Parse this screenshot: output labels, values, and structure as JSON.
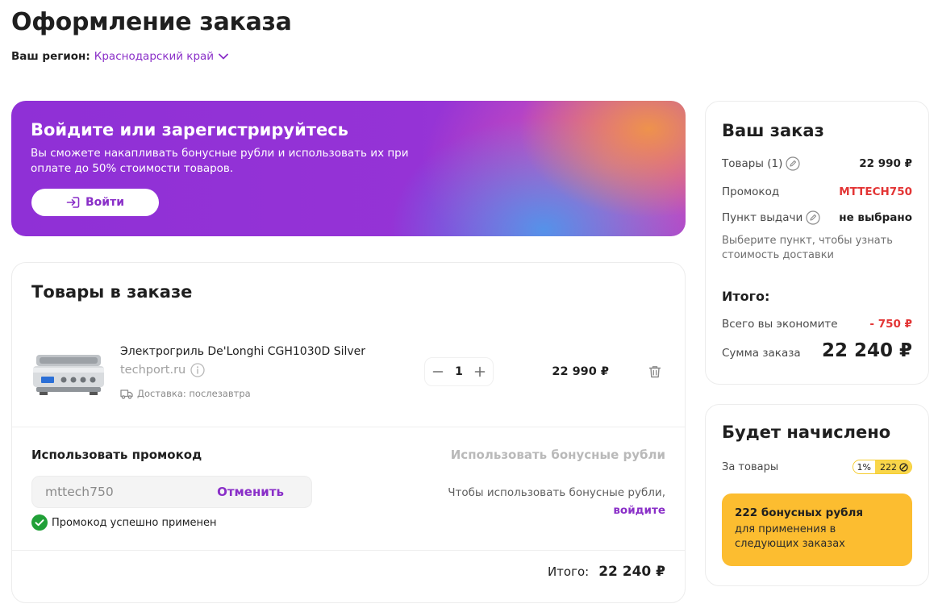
{
  "page": {
    "title": "Оформление заказа",
    "region_label": "Ваш регион:",
    "region_value": "Краснодарский край"
  },
  "banner": {
    "title": "Войдите или зарегистрируйтесь",
    "text": "Вы сможете накапливать бонусные рубли и использовать их при оплате до 50% стоимости товаров.",
    "login_label": "Войти"
  },
  "goods": {
    "title": "Товары в заказе",
    "items": [
      {
        "name": "Электрогриль De'Longhi CGH1030D Silver",
        "shop": "techport.ru",
        "delivery": "Доставка: послезавтра",
        "quantity": "1",
        "price": "22 990 ₽"
      }
    ],
    "promo_title": "Использовать промокод",
    "promo_value": "mttech750",
    "promo_cancel": "Отменить",
    "promo_success": "Промокод успешно применен",
    "bonus_title": "Использовать бонусные рубли",
    "bonus_hint": "Чтобы использовать бонусные рубли,",
    "bonus_hint_link": "войдите",
    "total_label": "Итого:",
    "total_value": "22 240 ₽"
  },
  "summary": {
    "title": "Ваш заказ",
    "goods_label": "Товары (1)",
    "goods_value": "22 990 ₽",
    "promo_label": "Промокод",
    "promo_value": "MTTECH750",
    "pickup_label": "Пункт выдачи",
    "pickup_value": "не выбрано",
    "delivery_note": "Выберите пункт, чтобы узнать стоимость доставки",
    "total_head": "Итого:",
    "savings_label": "Всего вы экономите",
    "savings_value": "- 750 ₽",
    "sum_label": "Сумма заказа",
    "sum_value": "22 240 ₽"
  },
  "bonus": {
    "title": "Будет начислено",
    "row_label": "За товары",
    "percent": "1%",
    "amount": "222",
    "box_title": "222 бонусных рубля",
    "box_text": "для применения в следующих заказах"
  },
  "colors": {
    "accent": "#8a2fc8",
    "discount": "#e33535",
    "success": "#21a038",
    "bonus": "#fcbd30"
  }
}
